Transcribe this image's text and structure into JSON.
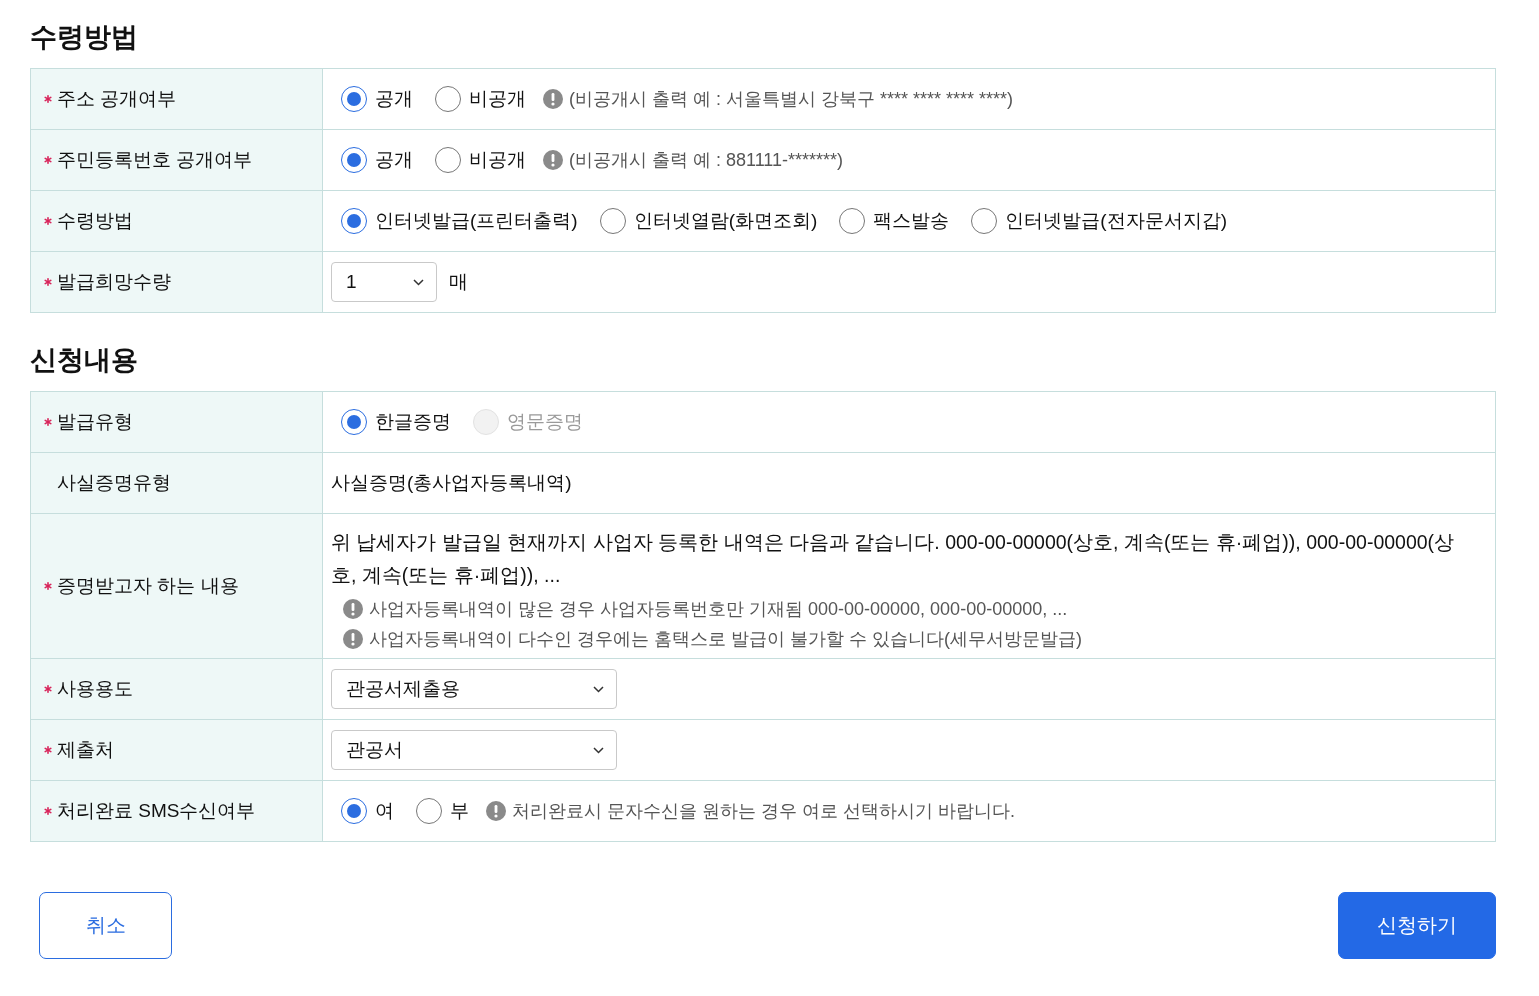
{
  "sections": [
    {
      "title": "수령방법",
      "rows": [
        {
          "label": "주소 공개여부",
          "required": true,
          "kind": "radio",
          "options": [
            {
              "label": "공개",
              "selected": true,
              "disabled": false
            },
            {
              "label": "비공개",
              "selected": false,
              "disabled": false
            }
          ],
          "note": "(비공개시 출력 예 : 서울특별시 강북구 **** **** **** ****)"
        },
        {
          "label": "주민등록번호 공개여부",
          "required": true,
          "kind": "radio",
          "options": [
            {
              "label": "공개",
              "selected": true,
              "disabled": false
            },
            {
              "label": "비공개",
              "selected": false,
              "disabled": false
            }
          ],
          "note": "(비공개시 출력 예 : 881111-*******)"
        },
        {
          "label": "수령방법",
          "required": true,
          "kind": "radio",
          "options": [
            {
              "label": "인터넷발급(프린터출력)",
              "selected": true,
              "disabled": false
            },
            {
              "label": "인터넷열람(화면조회)",
              "selected": false,
              "disabled": false
            },
            {
              "label": "팩스발송",
              "selected": false,
              "disabled": false
            },
            {
              "label": "인터넷발급(전자문서지갑)",
              "selected": false,
              "disabled": false
            }
          ]
        },
        {
          "label": "발급희망수량",
          "required": true,
          "kind": "select",
          "value": "1",
          "unit": "매"
        }
      ]
    },
    {
      "title": "신청내용",
      "rows": [
        {
          "label": "발급유형",
          "required": true,
          "kind": "radio",
          "options": [
            {
              "label": "한글증명",
              "selected": true,
              "disabled": false
            },
            {
              "label": "영문증명",
              "selected": false,
              "disabled": true
            }
          ]
        },
        {
          "label": "사실증명유형",
          "required": false,
          "kind": "text",
          "value": "사실증명(총사업자등록내역)"
        },
        {
          "label": "증명받고자 하는 내용",
          "required": true,
          "kind": "content",
          "value": "위 납세자가 발급일 현재까지 사업자 등록한 내역은 다음과 같습니다. 000-00-00000(상호, 계속(또는 휴·폐업)), 000-00-00000(상호, 계속(또는 휴·폐업)), ...",
          "notes": [
            "사업자등록내역이 많은 경우 사업자등록번호만 기재됨 000-00-00000, 000-00-00000, ...",
            "사업자등록내역이 다수인 경우에는 홈택스로 발급이 불가할 수 있습니다(세무서방문발급)"
          ]
        },
        {
          "label": "사용용도",
          "required": true,
          "kind": "select",
          "value": "관공서제출용"
        },
        {
          "label": "제출처",
          "required": true,
          "kind": "select",
          "value": "관공서"
        },
        {
          "label": "처리완료 SMS수신여부",
          "required": true,
          "kind": "radio",
          "options": [
            {
              "label": "여",
              "selected": true,
              "disabled": false
            },
            {
              "label": "부",
              "selected": false,
              "disabled": false
            }
          ],
          "note": "처리완료시 문자수신을 원하는 경우 여로 선택하시기 바랍니다."
        }
      ]
    }
  ],
  "buttons": [
    {
      "label": "취소",
      "kind": "secondary"
    },
    {
      "label": "신청하기",
      "kind": "primary"
    }
  ]
}
